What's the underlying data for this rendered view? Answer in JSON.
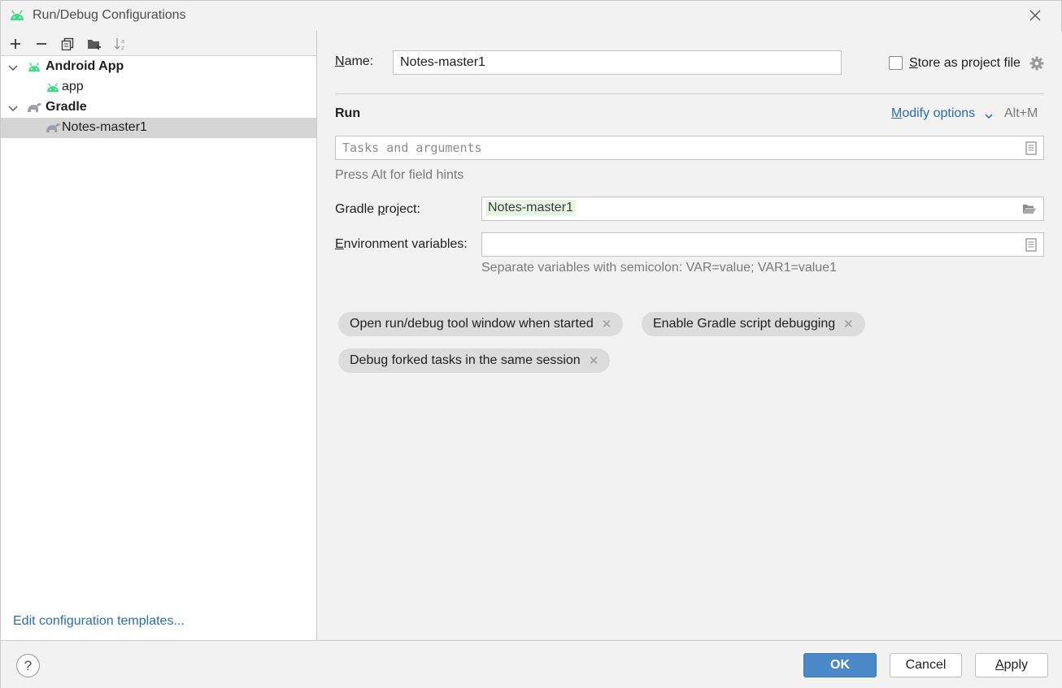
{
  "window": {
    "title": "Run/Debug Configurations"
  },
  "colors": {
    "android_green": "#3ddc84",
    "gradle_gray": "#9aa0a6",
    "link_blue": "#2b6cb0",
    "primary_button": "#4a88c7",
    "selection": "#d5d5d5",
    "chip_bg": "#dcdcdc"
  },
  "toolbar": {
    "icons": [
      "add-icon",
      "remove-icon",
      "copy-icon",
      "new-folder-icon",
      "sort-icon"
    ]
  },
  "tree": {
    "groups": [
      {
        "label": "Android App",
        "expanded": true,
        "icon": "android-icon",
        "children": [
          {
            "label": "app",
            "icon": "android-icon",
            "selected": false
          }
        ]
      },
      {
        "label": "Gradle",
        "expanded": true,
        "icon": "gradle-icon",
        "children": [
          {
            "label": "Notes-master1",
            "icon": "gradle-icon",
            "selected": true
          }
        ]
      }
    ]
  },
  "left_footer": {
    "edit_templates": "Edit configuration templates..."
  },
  "form": {
    "name_label_u": "N",
    "name_label_rest": "ame:",
    "name_value": "Notes-master1",
    "store_label_u": "S",
    "store_label_rest": "tore as project file",
    "store_checked": false,
    "section_run": "Run",
    "modify_options_u": "M",
    "modify_options_rest": "odify options",
    "modify_shortcut": "Alt+M",
    "tasks_placeholder": "Tasks and arguments",
    "field_hint": "Press Alt for field hints",
    "gradle_project_label_a": "Gradle ",
    "gradle_project_label_u": "p",
    "gradle_project_label_b": "roject:",
    "gradle_project_value": "Notes-master1",
    "env_label_u": "E",
    "env_label_rest": "nvironment variables:",
    "env_value": "",
    "env_hint": "Separate variables with semicolon: VAR=value; VAR1=value1"
  },
  "options": [
    "Open run/debug tool window when started",
    "Enable Gradle script debugging",
    "Debug forked tasks in the same session"
  ],
  "buttons": {
    "help": "?",
    "ok": "OK",
    "cancel": "Cancel",
    "apply_u": "A",
    "apply_rest": "pply"
  }
}
